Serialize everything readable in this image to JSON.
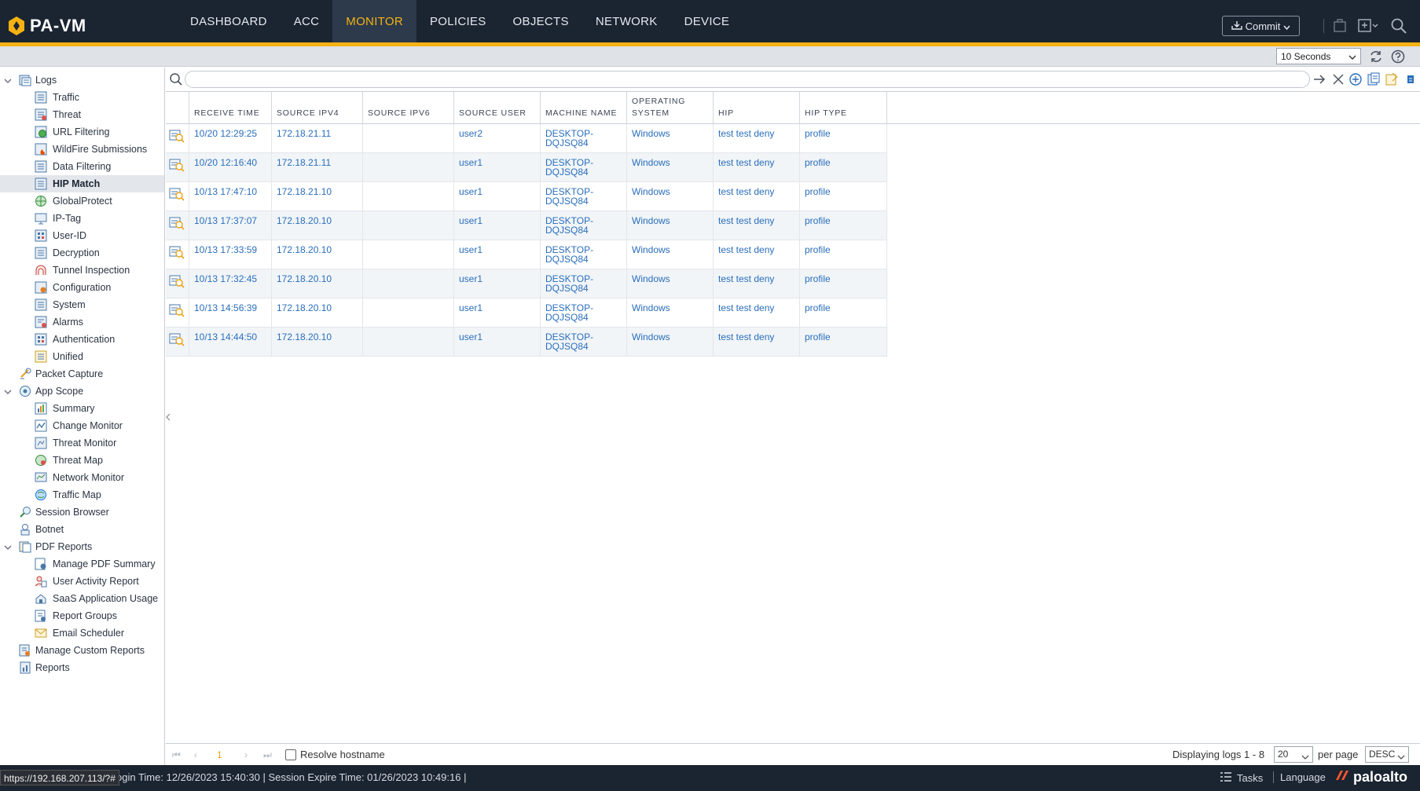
{
  "app": {
    "name": "PA-VM"
  },
  "nav": {
    "tabs": [
      {
        "label": "DASHBOARD"
      },
      {
        "label": "ACC"
      },
      {
        "label": "MONITOR"
      },
      {
        "label": "POLICIES"
      },
      {
        "label": "OBJECTS"
      },
      {
        "label": "NETWORK"
      },
      {
        "label": "DEVICE"
      }
    ],
    "active": "MONITOR",
    "commit_label": "Commit"
  },
  "toolbar": {
    "refresh_interval": "10 Seconds"
  },
  "sidebar": {
    "logs": "Logs",
    "log_items": [
      "Traffic",
      "Threat",
      "URL Filtering",
      "WildFire Submissions",
      "Data Filtering",
      "HIP Match",
      "GlobalProtect",
      "IP-Tag",
      "User-ID",
      "Decryption",
      "Tunnel Inspection",
      "Configuration",
      "System",
      "Alarms",
      "Authentication",
      "Unified"
    ],
    "selected": "HIP Match",
    "packet_capture": "Packet Capture",
    "app_scope": "App Scope",
    "app_scope_items": [
      "Summary",
      "Change Monitor",
      "Threat Monitor",
      "Threat Map",
      "Network Monitor",
      "Traffic Map"
    ],
    "session_browser": "Session Browser",
    "botnet": "Botnet",
    "pdf_reports": "PDF Reports",
    "pdf_items": [
      "Manage PDF Summary",
      "User Activity Report",
      "SaaS Application Usage",
      "Report Groups",
      "Email Scheduler"
    ],
    "manage_custom_reports": "Manage Custom Reports",
    "reports": "Reports"
  },
  "filter": {
    "placeholder": ""
  },
  "table": {
    "columns": [
      {
        "label": "RECEIVE TIME"
      },
      {
        "label": "SOURCE IPV4"
      },
      {
        "label": "SOURCE IPV6"
      },
      {
        "label": "SOURCE USER"
      },
      {
        "label": "MACHINE NAME"
      },
      {
        "label": "OPERATING\nSYSTEM"
      },
      {
        "label": "HIP"
      },
      {
        "label": "HIP TYPE"
      }
    ],
    "rows": [
      {
        "time": "10/20 12:29:25",
        "ipv4": "172.18.21.11",
        "ipv6": "",
        "user": "user2",
        "machine": "DESKTOP-\nDQJSQ84",
        "os": "Windows",
        "hip": "test test deny",
        "hip_type": "profile"
      },
      {
        "time": "10/20 12:16:40",
        "ipv4": "172.18.21.11",
        "ipv6": "",
        "user": "user1",
        "machine": "DESKTOP-\nDQJSQ84",
        "os": "Windows",
        "hip": "test test deny",
        "hip_type": "profile"
      },
      {
        "time": "10/13 17:47:10",
        "ipv4": "172.18.21.10",
        "ipv6": "",
        "user": "user1",
        "machine": "DESKTOP-\nDQJSQ84",
        "os": "Windows",
        "hip": "test test deny",
        "hip_type": "profile"
      },
      {
        "time": "10/13 17:37:07",
        "ipv4": "172.18.20.10",
        "ipv6": "",
        "user": "user1",
        "machine": "DESKTOP-\nDQJSQ84",
        "os": "Windows",
        "hip": "test test deny",
        "hip_type": "profile"
      },
      {
        "time": "10/13 17:33:59",
        "ipv4": "172.18.20.10",
        "ipv6": "",
        "user": "user1",
        "machine": "DESKTOP-\nDQJSQ84",
        "os": "Windows",
        "hip": "test test deny",
        "hip_type": "profile"
      },
      {
        "time": "10/13 17:32:45",
        "ipv4": "172.18.20.10",
        "ipv6": "",
        "user": "user1",
        "machine": "DESKTOP-\nDQJSQ84",
        "os": "Windows",
        "hip": "test test deny",
        "hip_type": "profile"
      },
      {
        "time": "10/13 14:56:39",
        "ipv4": "172.18.20.10",
        "ipv6": "",
        "user": "user1",
        "machine": "DESKTOP-\nDQJSQ84",
        "os": "Windows",
        "hip": "test test deny",
        "hip_type": "profile"
      },
      {
        "time": "10/13 14:44:50",
        "ipv4": "172.18.20.10",
        "ipv6": "",
        "user": "user1",
        "machine": "DESKTOP-\nDQJSQ84",
        "os": "Windows",
        "hip": "test test deny",
        "hip_type": "profile"
      }
    ]
  },
  "pager": {
    "page": "1",
    "resolve_hostname": "Resolve hostname",
    "display_text": "Displaying logs 1 - 8",
    "per_page_value": "20",
    "per_page_label": "per page",
    "order": "DESC"
  },
  "status": {
    "url_tooltip": "https://192.168.207.113/?#",
    "session_text": "ogin Time: 12/26/2023 15:40:30 | Session Expire Time: 01/26/2023 10:49:16 |",
    "tasks": "Tasks",
    "language": "Language",
    "brand": "paloalto"
  },
  "colors": {
    "nav_bg": "#1b2431",
    "accent": "#f5b212",
    "link": "#2a6ebb"
  }
}
